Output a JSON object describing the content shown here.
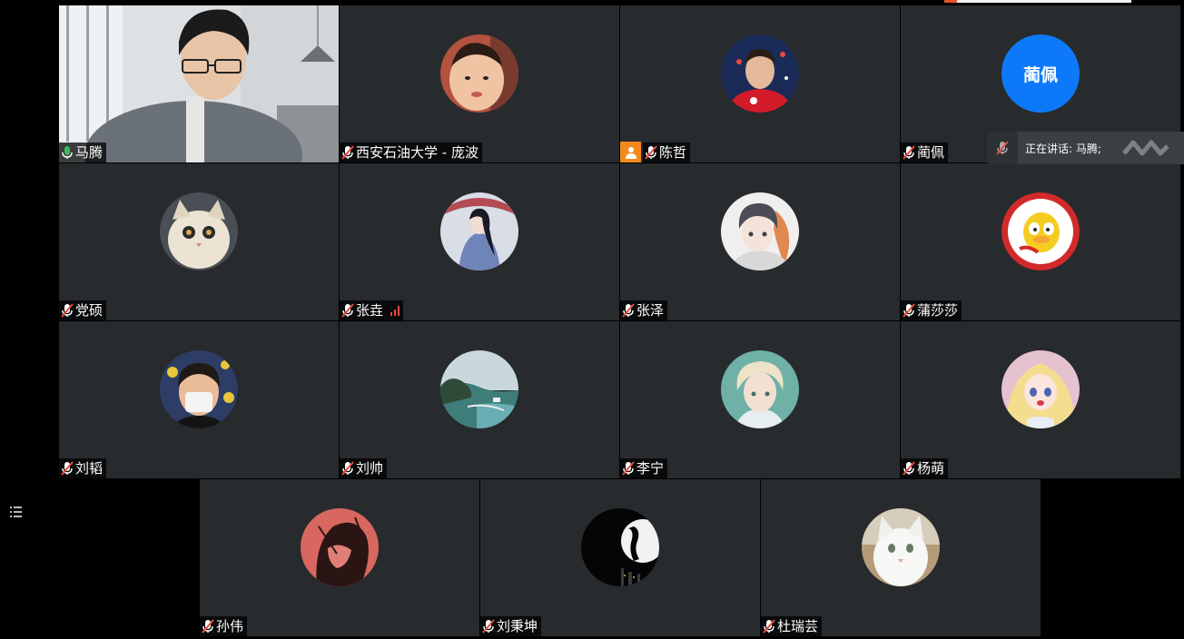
{
  "colors": {
    "tile_bg": "#272b2d",
    "active_border": "#3dbb55",
    "avatar_blue": "#0e79f8",
    "host_badge": "#f48a1e",
    "muted_mic": "#e84a3f",
    "active_mic": "#3dbb55"
  },
  "speaking": {
    "label": "正在讲话: 马腾;"
  },
  "participants": [
    {
      "name": "马腾",
      "mic": "active",
      "video": true
    },
    {
      "name": "西安石油大学 - 庞波",
      "mic": "muted",
      "avatar": "baby-photo"
    },
    {
      "name": "陈哲",
      "mic": "muted",
      "host": true,
      "avatar": "soccer-player-photo"
    },
    {
      "name": "蔺佩",
      "mic": "muted",
      "avatar_text": "蔺佩"
    },
    {
      "name": "党硕",
      "mic": "muted",
      "avatar": "cat-photo"
    },
    {
      "name": "张垚",
      "mic": "muted",
      "signal": "weak",
      "avatar": "anime-umbrella"
    },
    {
      "name": "张泽",
      "mic": "muted",
      "avatar": "anime-boy-fox"
    },
    {
      "name": "蒲莎莎",
      "mic": "muted",
      "avatar": "duck-badge"
    },
    {
      "name": "刘韬",
      "mic": "muted",
      "avatar": "masked-boy-photo"
    },
    {
      "name": "刘帅",
      "mic": "muted",
      "avatar": "coast-landscape"
    },
    {
      "name": "李宁",
      "mic": "muted",
      "avatar": "anime-white-hair"
    },
    {
      "name": "杨萌",
      "mic": "muted",
      "avatar": "anime-girl-blonde"
    },
    {
      "name": "孙伟",
      "mic": "muted",
      "avatar": "red-manga"
    },
    {
      "name": "刘秉坤",
      "mic": "muted",
      "avatar": "moon-silhouette"
    },
    {
      "name": "杜瑞芸",
      "mic": "muted",
      "avatar": "white-cat-photo"
    }
  ]
}
